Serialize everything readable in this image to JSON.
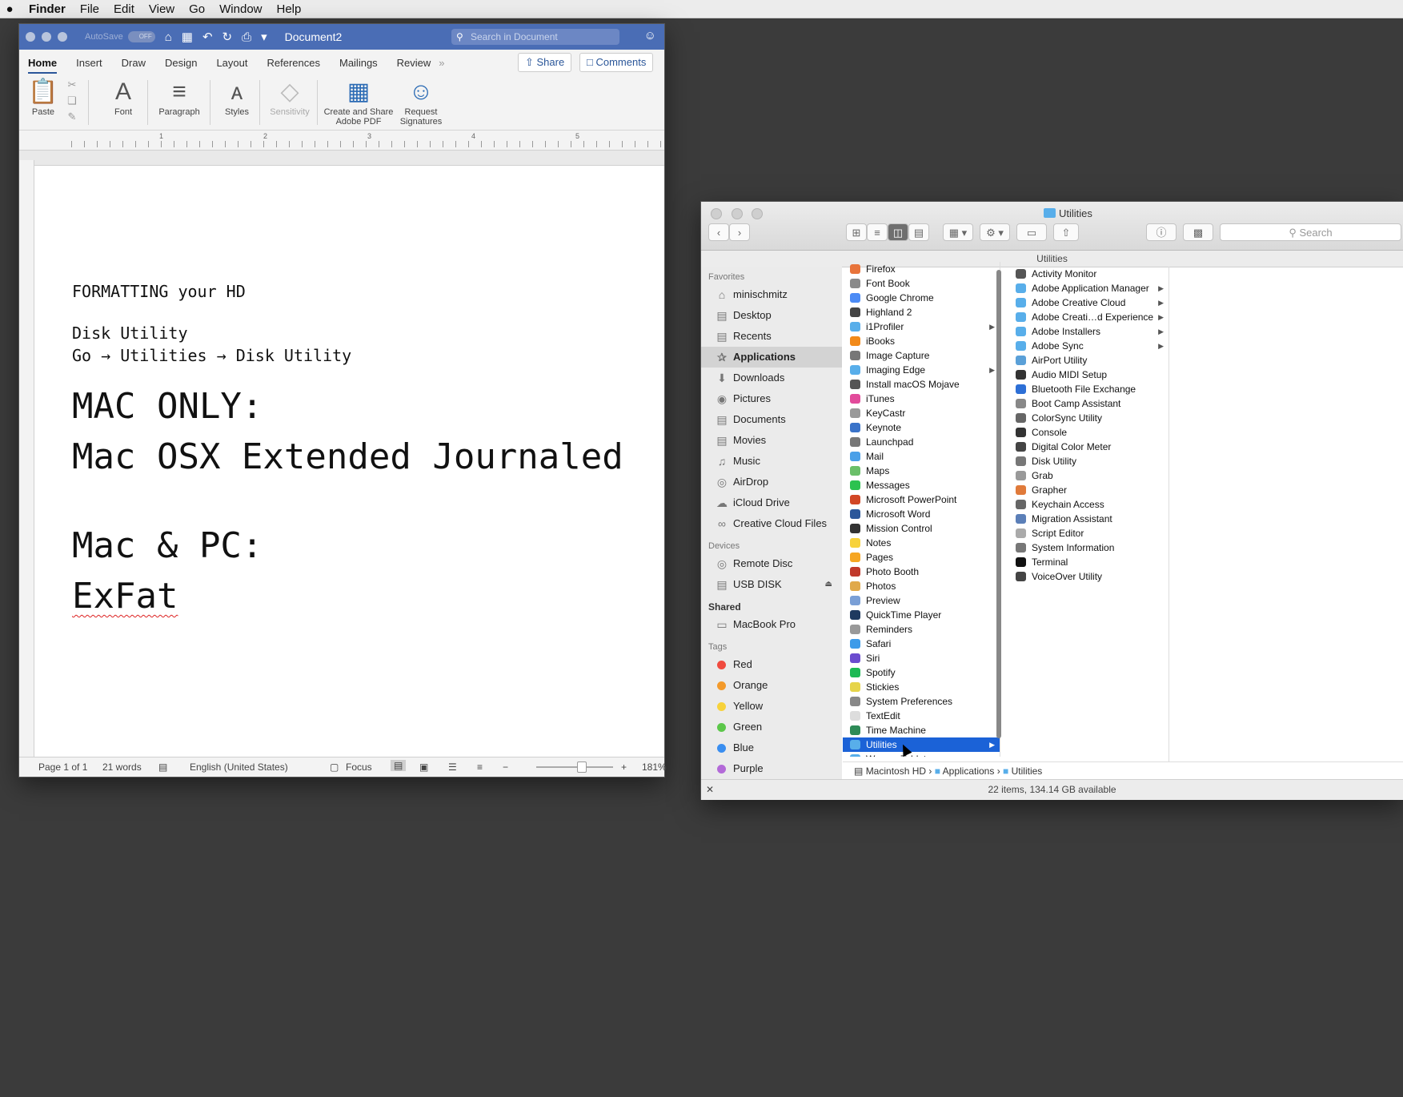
{
  "menubar": {
    "apple": "",
    "app": "Finder",
    "items": [
      "File",
      "Edit",
      "View",
      "Go",
      "Window",
      "Help"
    ]
  },
  "word": {
    "autosave": "AutoSave",
    "autosave_state": "OFF",
    "title": "Document2",
    "search_placeholder": "Search in Document",
    "tabs": [
      "Home",
      "Insert",
      "Draw",
      "Design",
      "Layout",
      "References",
      "Mailings",
      "Review"
    ],
    "more": "»",
    "share": "Share",
    "comments": "Comments",
    "ribbon": {
      "paste": "Paste",
      "font": "Font",
      "paragraph": "Paragraph",
      "styles": "Styles",
      "sensitivity": "Sensitivity",
      "adobe1": "Create and Share",
      "adobe2": "Adobe PDF",
      "sig1": "Request",
      "sig2": "Signatures"
    },
    "ruler": [
      "1",
      "2",
      "3",
      "4",
      "5"
    ],
    "doc": {
      "line1": "FORMATTING your HD",
      "line2": "Disk Utility",
      "line3": "Go → Utilities → Disk Utility",
      "big1": "MAC ONLY:",
      "big2": "Mac OSX Extended Journaled",
      "big3": "Mac & PC:",
      "big4": "ExFat"
    },
    "status": {
      "page": "Page 1 of 1",
      "words": "21 words",
      "lang": "English (United States)",
      "focus": "Focus",
      "zoom": "181%"
    }
  },
  "finder": {
    "title": "Utilities",
    "search_placeholder": "Search",
    "path_header": "Utilities",
    "sidebar": {
      "favorites_label": "Favorites",
      "favorites": [
        "minischmitz",
        "Desktop",
        "Recents",
        "Applications",
        "Downloads",
        "Pictures",
        "Documents",
        "Movies",
        "Music",
        "AirDrop",
        "iCloud Drive",
        "Creative Cloud Files"
      ],
      "devices_label": "Devices",
      "devices": [
        "Remote Disc",
        "USB DISK"
      ],
      "shared_label": "Shared",
      "shared": [
        "MacBook Pro"
      ],
      "tags_label": "Tags",
      "tags": [
        {
          "name": "Red",
          "color": "#f04b3f"
        },
        {
          "name": "Orange",
          "color": "#f39a2b"
        },
        {
          "name": "Yellow",
          "color": "#f7d23b"
        },
        {
          "name": "Green",
          "color": "#5cc74a"
        },
        {
          "name": "Blue",
          "color": "#3a8ef0"
        },
        {
          "name": "Purple",
          "color": "#b36ad8"
        }
      ]
    },
    "apps": [
      "Firefox",
      "Font Book",
      "Google Chrome",
      "Highland 2",
      "i1Profiler",
      "iBooks",
      "Image Capture",
      "Imaging Edge",
      "Install macOS Mojave",
      "iTunes",
      "KeyCastr",
      "Keynote",
      "Launchpad",
      "Mail",
      "Maps",
      "Messages",
      "Microsoft PowerPoint",
      "Microsoft Word",
      "Mission Control",
      "Notes",
      "Pages",
      "Photo Booth",
      "Photos",
      "Preview",
      "QuickTime Player",
      "Reminders",
      "Safari",
      "Siri",
      "Spotify",
      "Stickies",
      "System Preferences",
      "TextEdit",
      "Time Machine",
      "Utilities",
      "Wacom Tablet"
    ],
    "utilities": [
      "Activity Monitor",
      "Adobe Application Manager",
      "Adobe Creative Cloud",
      "Adobe Creati…d Experience",
      "Adobe Installers",
      "Adobe Sync",
      "AirPort Utility",
      "Audio MIDI Setup",
      "Bluetooth File Exchange",
      "Boot Camp Assistant",
      "ColorSync Utility",
      "Console",
      "Digital Color Meter",
      "Disk Utility",
      "Grab",
      "Grapher",
      "Keychain Access",
      "Migration Assistant",
      "Script Editor",
      "System Information",
      "Terminal",
      "VoiceOver Utility"
    ],
    "path": [
      "Macintosh HD",
      "Applications",
      "Utilities"
    ],
    "status": "22 items, 134.14 GB available"
  }
}
